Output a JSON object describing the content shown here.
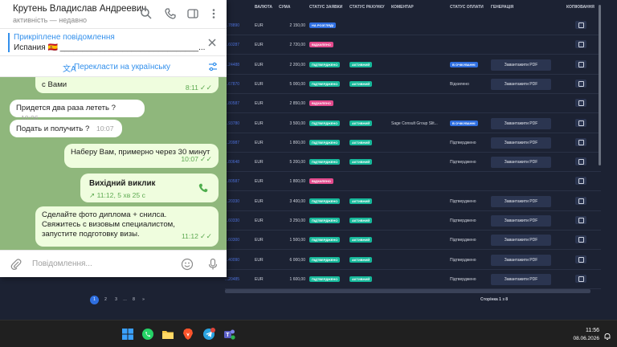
{
  "dashboard": {
    "headers": {
      "currency": "ВАЛЮТА",
      "amount": "СУМА",
      "app_status": "СТАТУС ЗАЯВКИ",
      "invoice_status": "СТАТУС РАХУНКУ",
      "comment": "КОМЕНТАР",
      "payment_status": "СТАТУС ОПЛАТИ",
      "generation": "ГЕНЕРАЦІЯ",
      "copy": "КОПІЮВАННЯ"
    },
    "rows": [
      {
        "id": "...78890",
        "currency": "EUR",
        "amount": "2 150,00",
        "app_badge": "НА РОЗГЛЯДІ",
        "app_color": "blue",
        "inv_badge": "",
        "comment": "",
        "pay_badge": "",
        "pay_text": "",
        "pdf": ""
      },
      {
        "id": "...60287",
        "currency": "EUR",
        "amount": "2 720,00",
        "app_badge": "ВІДХИЛЕНО",
        "app_color": "pink",
        "inv_badge": "",
        "comment": "",
        "pay_badge": "",
        "pay_text": "",
        "pdf": ""
      },
      {
        "id": "...24488",
        "currency": "EUR",
        "amount": "2 200,00",
        "app_badge": "ПІДТВЕРДЖЕНО",
        "app_color": "teal",
        "inv_badge": "АКТИВНИЙ",
        "comment": "",
        "pay_badge": "В ОЧІКУВАННІ",
        "pay_text": "",
        "pdf": "Завантажити PDF"
      },
      {
        "id": "...67870",
        "currency": "EUR",
        "amount": "5 000,00",
        "app_badge": "ПІДТВЕРДЖЕНО",
        "app_color": "teal",
        "inv_badge": "АКТИВНИЙ",
        "comment": "",
        "pay_badge": "",
        "pay_text": "Відхилено",
        "pdf": "Завантажити PDF"
      },
      {
        "id": "...80587",
        "currency": "EUR",
        "amount": "2 850,00",
        "app_badge": "ВІДХИЛЕНО",
        "app_color": "pink",
        "inv_badge": "",
        "comment": "",
        "pay_badge": "",
        "pay_text": "",
        "pdf": ""
      },
      {
        "id": "...93780",
        "currency": "EUR",
        "amount": "3 500,00",
        "app_badge": "ПІДТВЕРДЖЕНО",
        "app_color": "teal",
        "inv_badge": "АКТИВНИЙ",
        "comment": "Sage Consult Group Slit...",
        "pay_badge": "В ОЧІКУВАННІ",
        "pay_text": "",
        "pdf": "Завантажити PDF"
      },
      {
        "id": "...20987",
        "currency": "EUR",
        "amount": "1 800,00",
        "app_badge": "ПІДТВЕРДЖЕНО",
        "app_color": "teal",
        "inv_badge": "АКТИВНИЙ",
        "comment": "",
        "pay_badge": "",
        "pay_text": "Підтверджено",
        "pdf": "Завантажити PDF"
      },
      {
        "id": "...80648",
        "currency": "EUR",
        "amount": "5 200,00",
        "app_badge": "ПІДТВЕРДЖЕНО",
        "app_color": "teal",
        "inv_badge": "АКТИВНИЙ",
        "comment": "",
        "pay_badge": "",
        "pay_text": "Підтверджено",
        "pdf": "Завантажити PDF"
      },
      {
        "id": "...80587",
        "currency": "EUR",
        "amount": "1 800,00",
        "app_badge": "ВІДХИЛЕНО",
        "app_color": "pink",
        "inv_badge": "",
        "comment": "",
        "pay_badge": "",
        "pay_text": "",
        "pdf": ""
      },
      {
        "id": "...20330",
        "currency": "EUR",
        "amount": "3 400,00",
        "app_badge": "ПІДТВЕРДЖЕНО",
        "app_color": "teal",
        "inv_badge": "АКТИВНИЙ",
        "comment": "",
        "pay_badge": "",
        "pay_text": "Підтверджено",
        "pdf": "Завантажити PDF"
      },
      {
        "id": "...60330",
        "currency": "EUR",
        "amount": "3 250,00",
        "app_badge": "ПІДТВЕРДЖЕНО",
        "app_color": "teal",
        "inv_badge": "АКТИВНИЙ",
        "comment": "",
        "pay_badge": "",
        "pay_text": "Підтверджено",
        "pdf": "Завантажити PDF"
      },
      {
        "id": "...60300",
        "currency": "EUR",
        "amount": "1 500,00",
        "app_badge": "ПІДТВЕРДЖЕНО",
        "app_color": "teal",
        "inv_badge": "АКТИВНИЙ",
        "comment": "",
        "pay_badge": "",
        "pay_text": "Підтверджено",
        "pdf": "Завантажити PDF"
      },
      {
        "id": "...40090",
        "currency": "EUR",
        "amount": "6 000,00",
        "app_badge": "ПІДТВЕРДЖЕНО",
        "app_color": "teal",
        "inv_badge": "АКТИВНИЙ",
        "comment": "",
        "pay_badge": "",
        "pay_text": "Підтверджено",
        "pdf": "Завантажити PDF"
      },
      {
        "id": "...20485",
        "currency": "EUR",
        "amount": "1 600,00",
        "app_badge": "ПІДТВЕРДЖЕНО",
        "app_color": "teal",
        "inv_badge": "АКТИВНИЙ",
        "comment": "",
        "pay_badge": "",
        "pay_text": "Підтверджено",
        "pdf": "Завантажити PDF"
      }
    ],
    "pagination": {
      "pages": [
        "1",
        "2",
        "3",
        "…",
        "8",
        "»"
      ],
      "active": "1"
    },
    "page_info": "Сторінка 1 з 8"
  },
  "telegram": {
    "contact_name": "Крутень Владислав Андреевич",
    "contact_status": "активність — недавно",
    "pinned_title": "Прикріплене повідомлення",
    "pinned_text": "Испания 🇪🇸 _______________________________...",
    "translate_label": "Перекласти на українську",
    "input_placeholder": "Повідомлення...",
    "messages": [
      {
        "dir": "out",
        "text": "с Вами",
        "time": "8:11",
        "ticks": "✓✓"
      },
      {
        "dir": "in",
        "text": "Придется два раза лететь ?",
        "time": "10:06"
      },
      {
        "dir": "in",
        "text": "Подать и получить ?",
        "time": "10:07"
      },
      {
        "dir": "out",
        "text": "Наберу Вам, примерно через 30 минут",
        "time": "10:07",
        "ticks": "✓✓"
      },
      {
        "dir": "out",
        "call_title": "Вихідний виклик",
        "call_info": "↗ 11:12, 5 хв 25 с"
      },
      {
        "dir": "out",
        "text": "Сделайте фото диплома + снилса.\nСвяжитесь с визовым специалистом, запустите подготовку визы.",
        "time": "11:12",
        "ticks": "✓✓"
      }
    ]
  },
  "taskbar": {
    "time": "11:56",
    "date": "08.06.2026",
    "apps": [
      "windows-start",
      "whatsapp",
      "file-explorer",
      "brave-browser",
      "telegram",
      "teams"
    ]
  },
  "colors": {
    "accent": "#3390ec",
    "badge_teal": "#16b89a",
    "badge_pink": "#e34a8c",
    "badge_blue": "#2f6fe0"
  }
}
